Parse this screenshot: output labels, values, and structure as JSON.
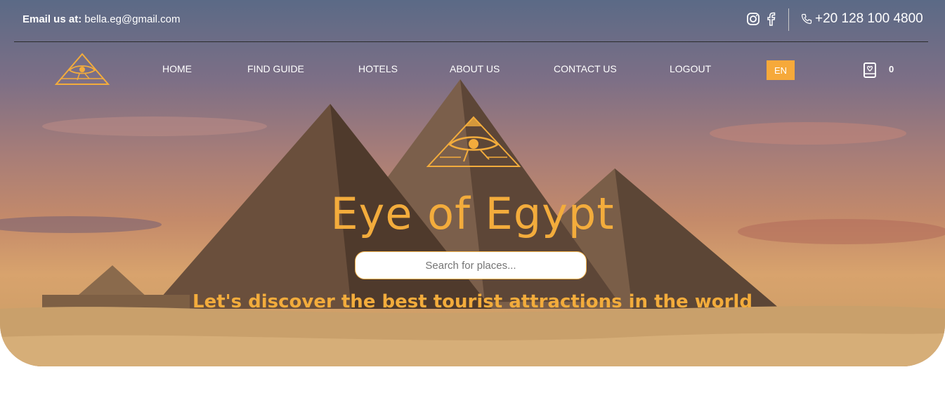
{
  "topbar": {
    "email_label": "Email us at:",
    "email_value": "bella.eg@gmail.com",
    "phone": "+20 128 100 4800",
    "socials": [
      "instagram-icon",
      "facebook-icon"
    ]
  },
  "nav": {
    "items": [
      "HOME",
      "FIND GUIDE",
      "HOTELS",
      "ABOUT US",
      "CONTACT US",
      "LOGOUT"
    ],
    "lang": "EN",
    "cart_count": "0"
  },
  "hero": {
    "title": "Eye of Egypt",
    "search_placeholder": "Search for places...",
    "tagline": "Let's discover the best tourist attractions in the world"
  },
  "colors": {
    "accent": "#f3ac3c",
    "nav_text": "#ffffff",
    "lang_bg": "#f6a93a"
  }
}
